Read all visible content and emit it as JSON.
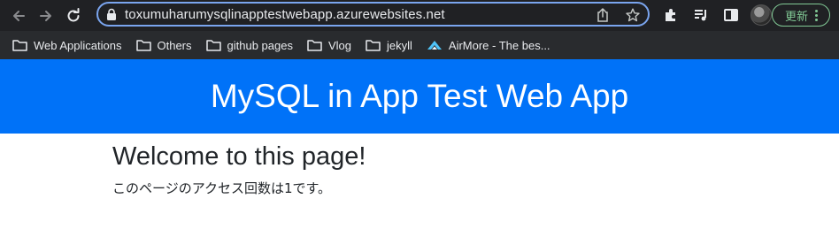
{
  "browser": {
    "url": "toxumuharumysqlinapptestwebapp.azurewebsites.net",
    "update_button_label": "更新",
    "icons": {
      "back": "arrow-left-icon",
      "forward": "arrow-right-icon",
      "reload": "reload-icon",
      "lock": "lock-icon",
      "share": "share-icon",
      "bookmark_star": "star-icon",
      "extensions": "puzzle-icon",
      "media": "media-playlist-icon",
      "sidebar": "side-panel-icon",
      "profile": "avatar"
    },
    "accent_color": "#7aa5ef",
    "update_color": "#81c995"
  },
  "bookmarks": [
    {
      "label": "Web Applications",
      "icon": "folder-icon"
    },
    {
      "label": "Others",
      "icon": "folder-icon"
    },
    {
      "label": "github pages",
      "icon": "folder-icon"
    },
    {
      "label": "Vlog",
      "icon": "folder-icon"
    },
    {
      "label": "jekyll",
      "icon": "folder-icon"
    },
    {
      "label": "AirMore - The bes...",
      "icon": "airmore-icon"
    }
  ],
  "page": {
    "header_title": "MySQL in App Test Web App",
    "header_color": "#0072f8",
    "heading": "Welcome to this page!",
    "message": "このページのアクセス回数は1です。"
  }
}
